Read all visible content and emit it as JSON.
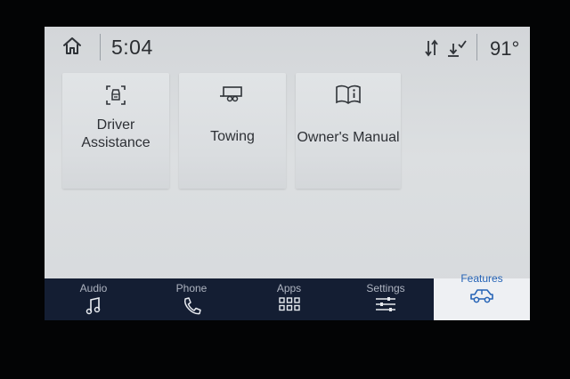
{
  "status": {
    "time": "5:04",
    "temperature": "91°",
    "icons": [
      "home-icon",
      "sync-arrows-icon",
      "download-check-icon"
    ]
  },
  "tiles": [
    {
      "label_line1": "Driver",
      "label_line2": "Assistance",
      "icon": "driver-assist-icon"
    },
    {
      "label": "Towing",
      "icon": "trailer-icon"
    },
    {
      "label": "Owner's Manual",
      "icon": "book-info-icon"
    }
  ],
  "nav": {
    "tabs": [
      {
        "label": "Audio",
        "icon": "music-note-icon"
      },
      {
        "label": "Phone",
        "icon": "phone-icon"
      },
      {
        "label": "Apps",
        "icon": "grid-icon"
      },
      {
        "label": "Settings",
        "icon": "sliders-icon"
      },
      {
        "label": "Features",
        "icon": "truck-icon",
        "active": true
      }
    ]
  },
  "colors": {
    "nav_background": "#141e33",
    "active_accent": "#2563b6",
    "screen_background": "#d8dbde"
  }
}
